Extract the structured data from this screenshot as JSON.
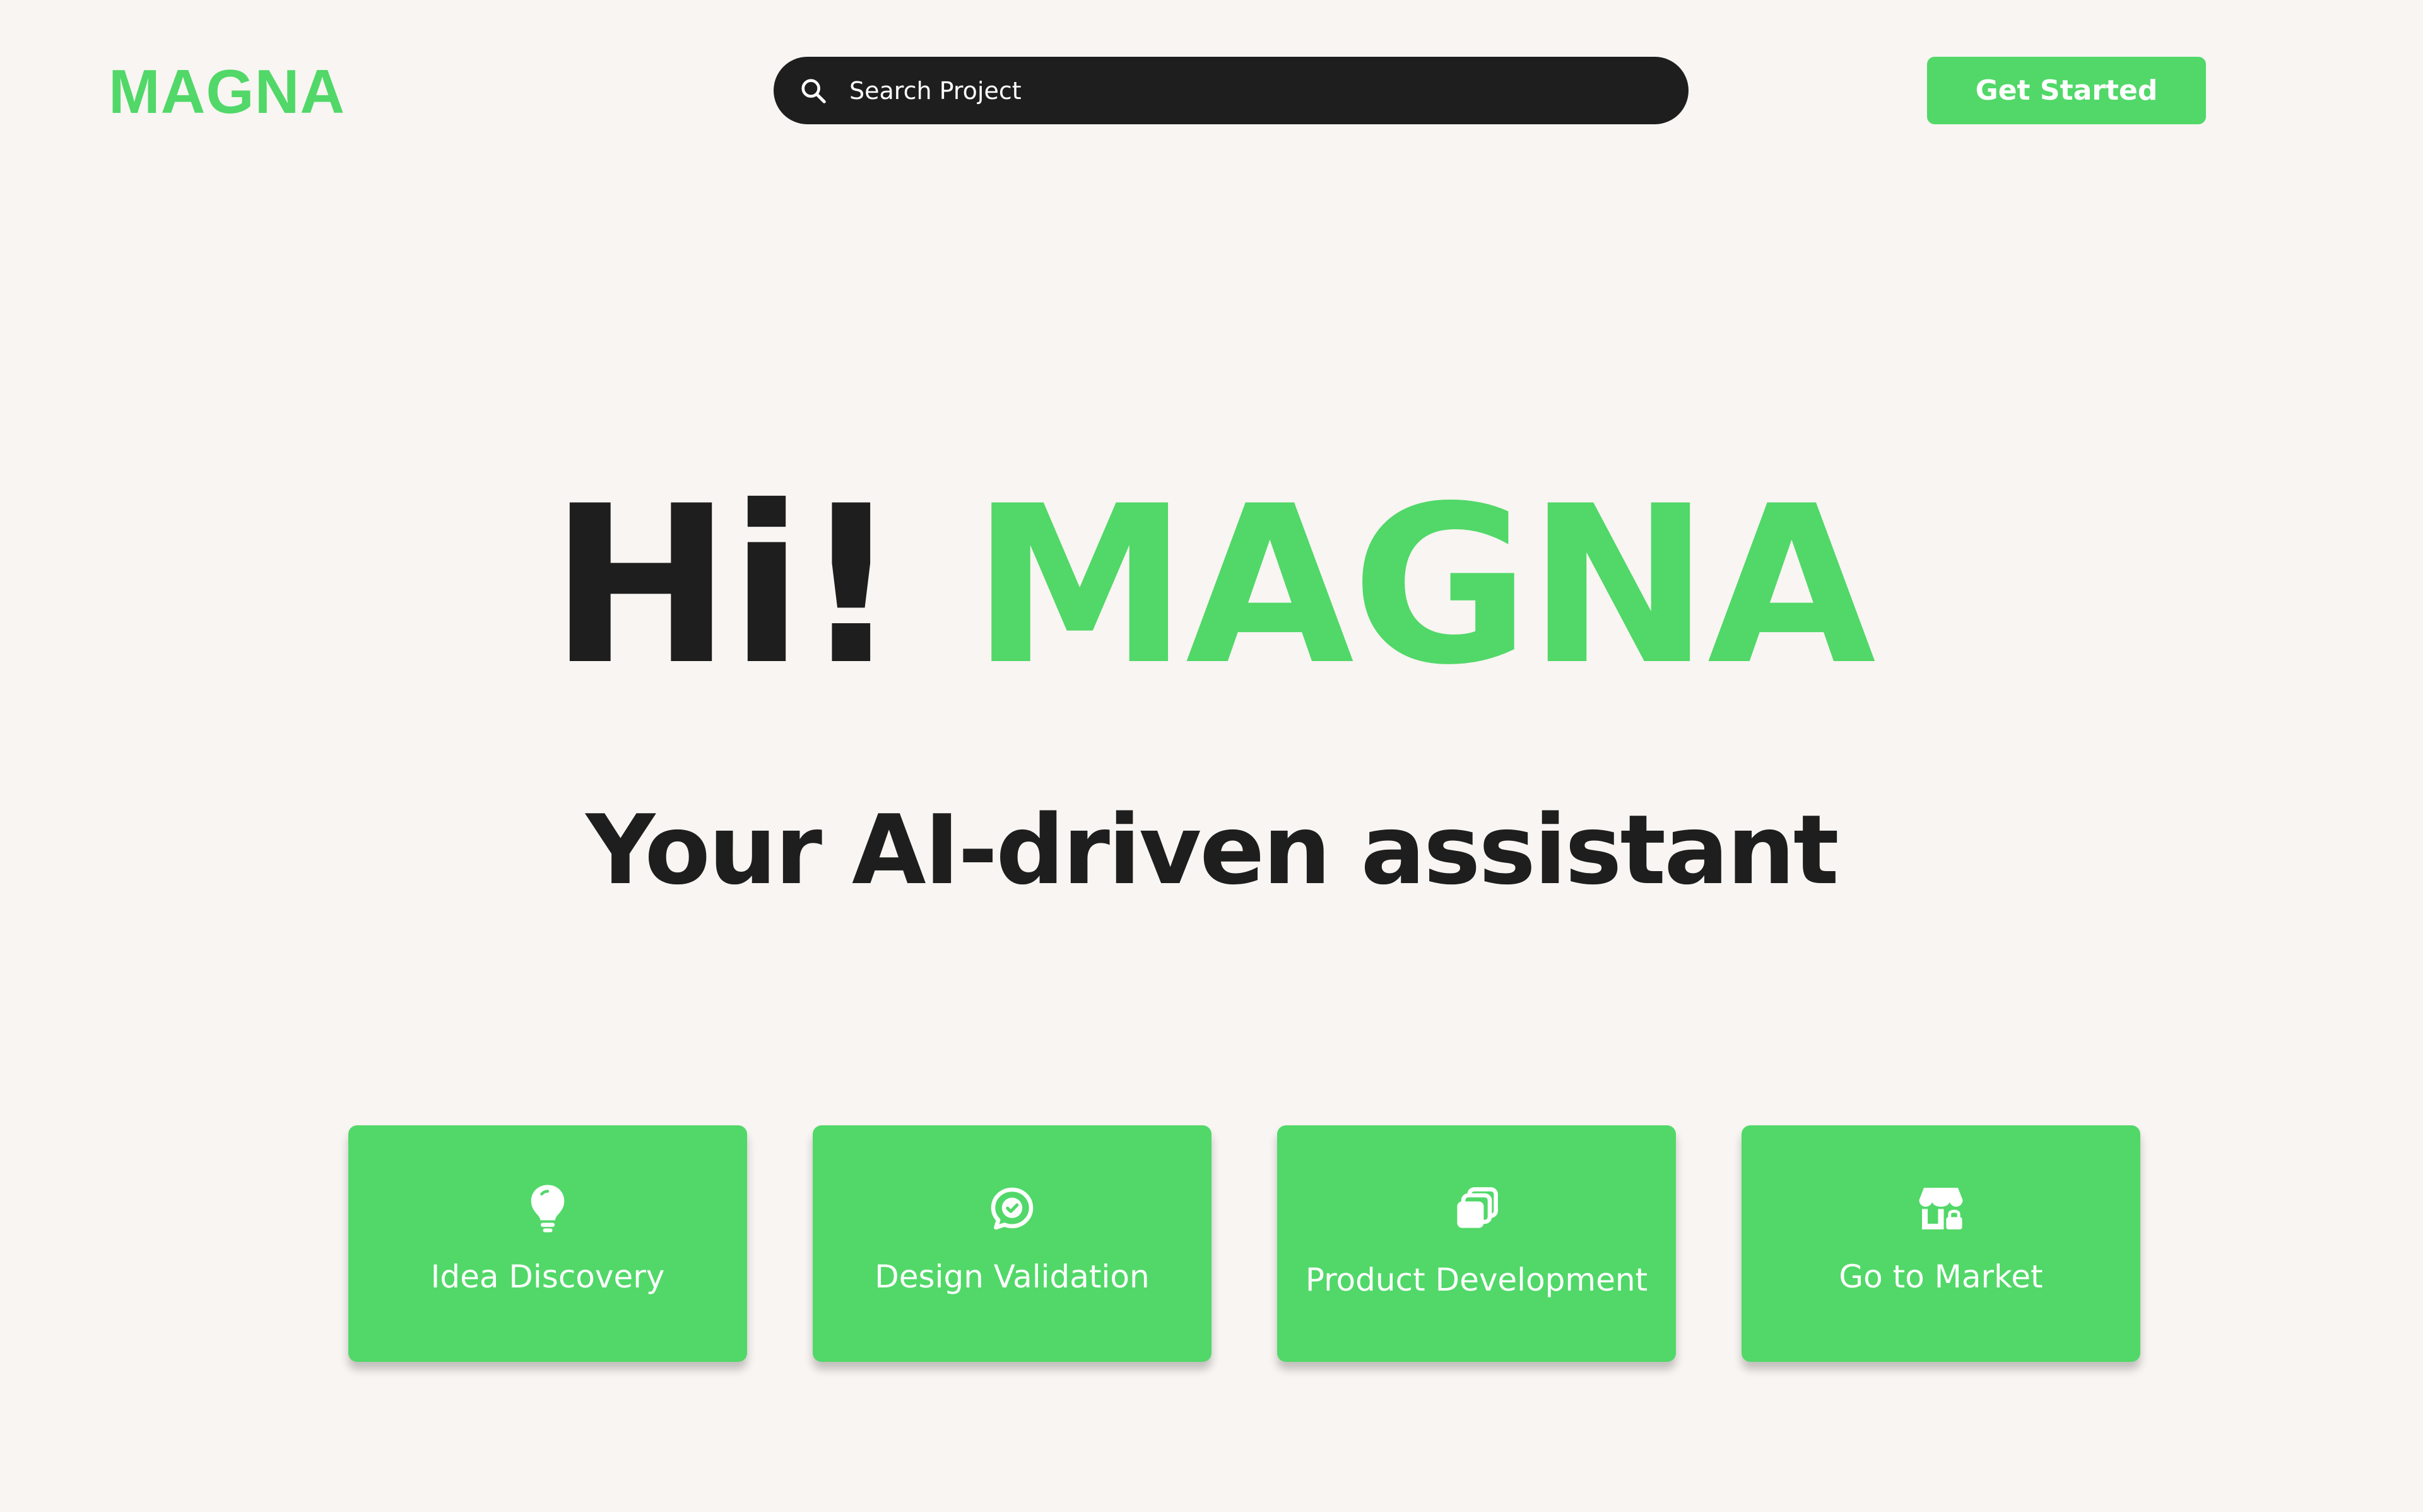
{
  "header": {
    "logo": "MAGNA",
    "search": {
      "placeholder": "Search Project",
      "value": ""
    },
    "cta_label": "Get Started"
  },
  "hero": {
    "greeting": "Hi!",
    "name": "MAGNA",
    "subtitle": "Your AI-driven assistant"
  },
  "cards": [
    {
      "label": "Idea Discovery",
      "icon": "lightbulb-icon"
    },
    {
      "label": "Design Validation",
      "icon": "chat-check-icon"
    },
    {
      "label": "Product Development",
      "icon": "copy-icon"
    },
    {
      "label": "Go to Market",
      "icon": "store-lock-icon"
    }
  ],
  "colors": {
    "background": "#f8f5f2",
    "accent": "#51d868",
    "dark": "#1e1e1e",
    "text_on_accent": "#ffffff"
  }
}
